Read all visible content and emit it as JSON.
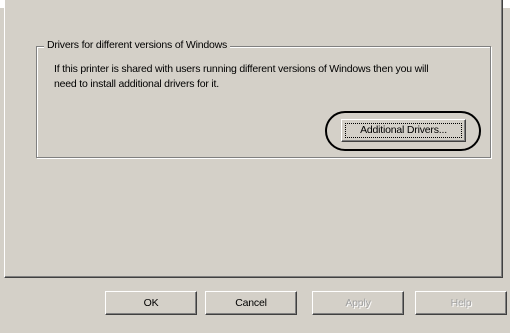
{
  "group": {
    "title": "Drivers for different versions of Windows",
    "description": "If this printer is shared with users running different versions of Windows then you will need to install additional drivers for it.",
    "add_drivers_label": "Additional Drivers..."
  },
  "buttons": {
    "ok": "OK",
    "cancel": "Cancel",
    "apply": "Apply",
    "help": "Help"
  },
  "state": {
    "apply_enabled": false,
    "help_enabled": false,
    "highlighted_control": "Additional Drivers..."
  }
}
